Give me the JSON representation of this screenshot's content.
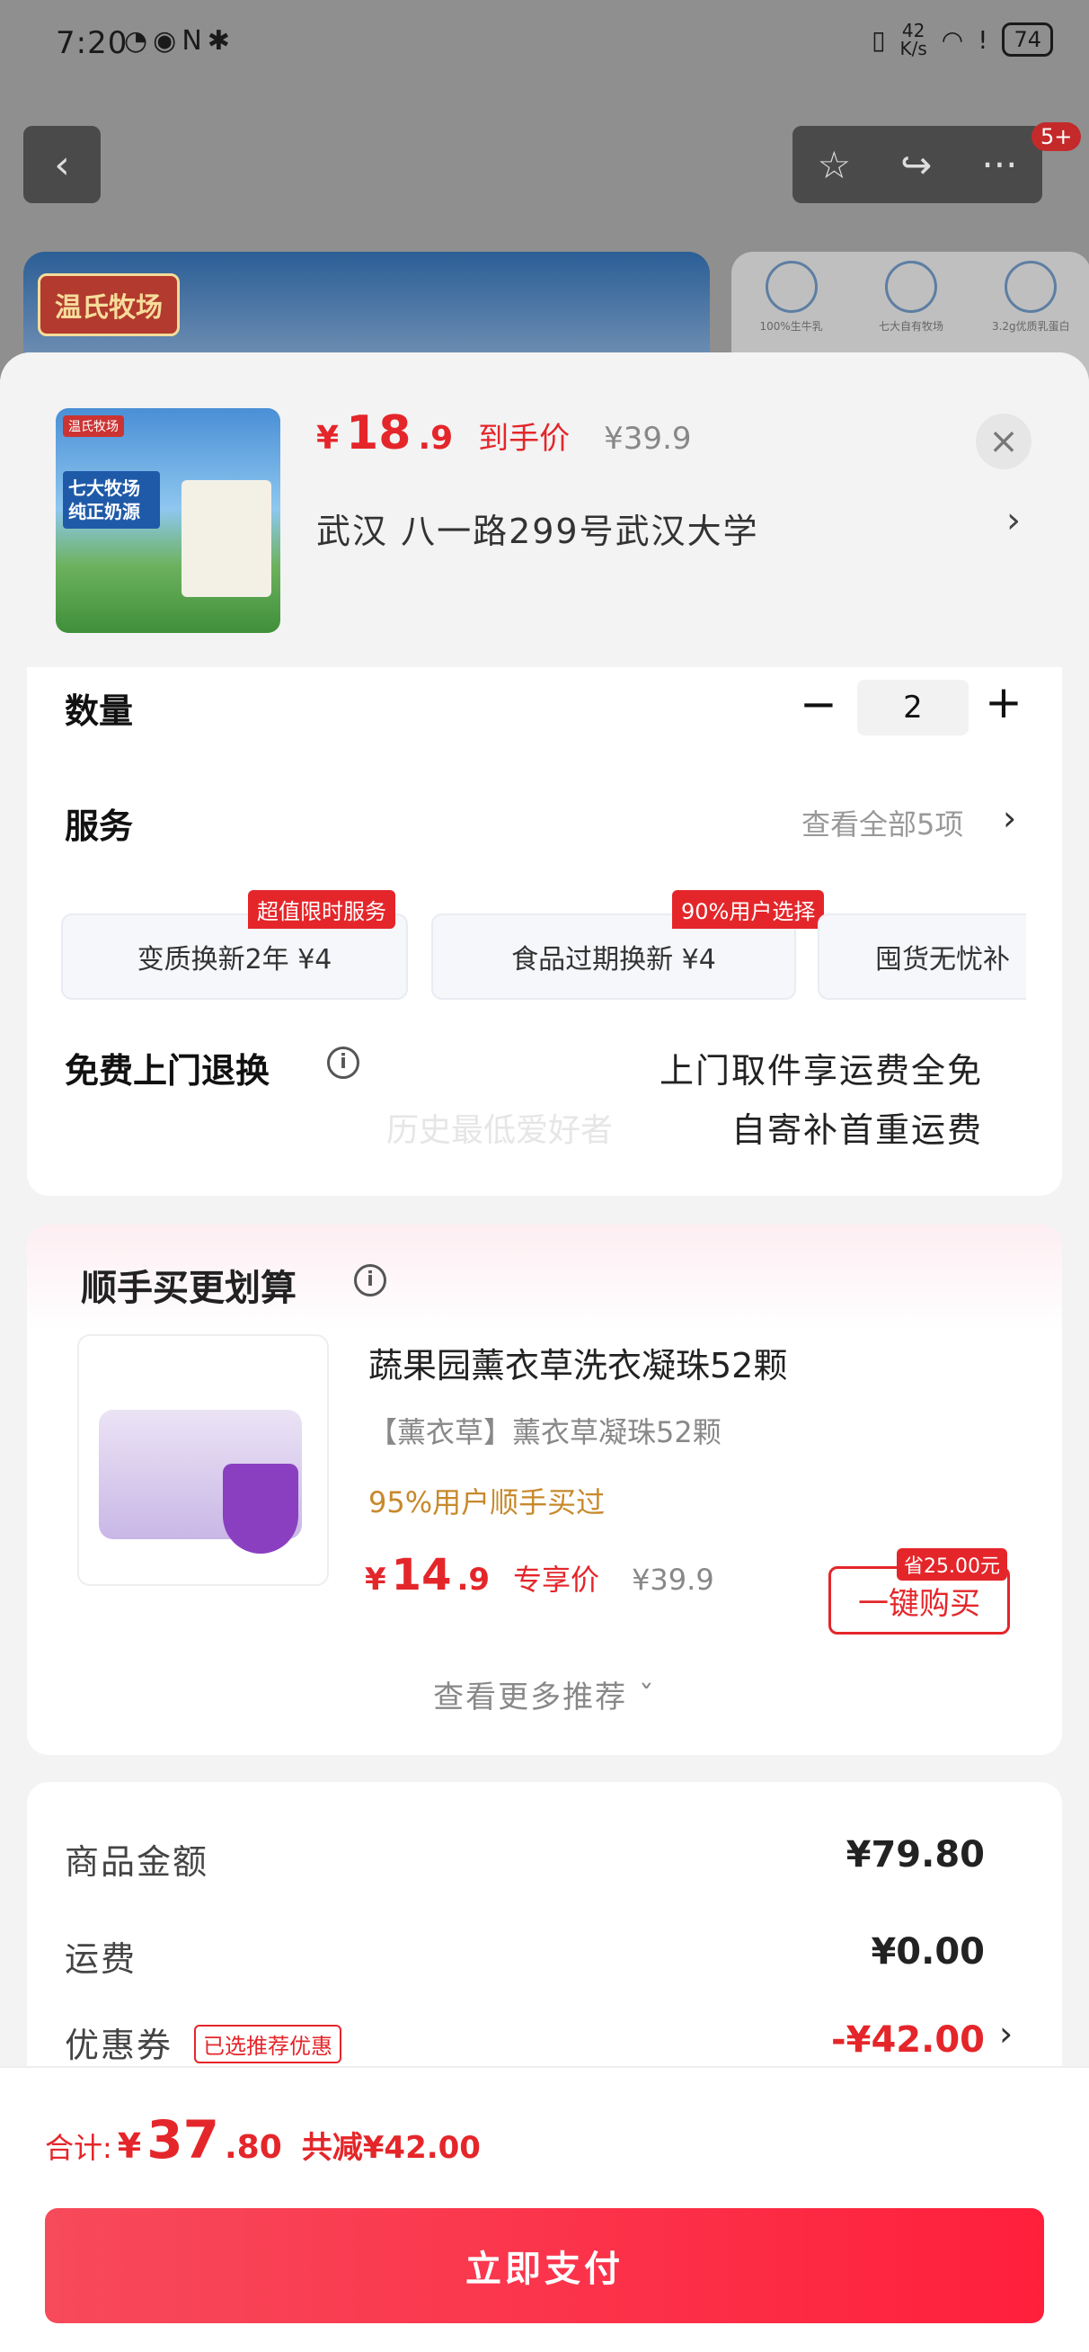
{
  "status_bar": {
    "time": "7:20",
    "left_icons": "◔◉N✱",
    "net_speed_value": "42",
    "net_speed_unit": "K/s",
    "battery": "74"
  },
  "nav": {
    "back_icon": "‹",
    "star_icon": "☆",
    "share_icon": "↪",
    "more_icon": "···",
    "cart_badge": "5+"
  },
  "banner": {
    "logo_text": "温氏牧场",
    "features": [
      "100%生牛乳",
      "七大自有牧场",
      "3.2g优质乳蛋白"
    ]
  },
  "product": {
    "thumb_tag": "温氏牧场",
    "thumb_text": "七大牧场 纯正奶源",
    "price_symbol": "¥",
    "price_int": "18",
    "price_dec": ".9",
    "price_label": "到手价",
    "original_price": "¥39.9",
    "close_icon": "×",
    "address": "武汉   八一路299号武汉大学",
    "address_chevron": "›"
  },
  "quantity": {
    "title": "数量",
    "minus": "−",
    "value": "2",
    "plus": "+"
  },
  "service": {
    "title": "服务",
    "view_all": "查看全部5项",
    "chevron": "›",
    "items": [
      {
        "label": "变质换新2年   ¥4",
        "tag": "超值限时服务"
      },
      {
        "label": "食品过期换新   ¥4",
        "tag": "90%用户选择"
      },
      {
        "label": "囤货无忧补"
      }
    ]
  },
  "returns": {
    "title": "免费上门退换",
    "info_icon": "i",
    "line1": "上门取件享运费全免",
    "line2": "自寄补首重运费",
    "watermark": "历史最低爱好者"
  },
  "addon": {
    "title": "顺手买更划算",
    "info_icon": "i",
    "name": "蔬果园薰衣草洗衣凝珠52颗",
    "variant": "【薰衣草】薰衣草凝珠52颗",
    "stat": "95%用户顺手买过",
    "price_symbol": "¥",
    "price_int": "14",
    "price_dec": ".9",
    "price_label": "专享价",
    "original_price": "¥39.9",
    "save_tag": "省25.00元",
    "buy_label": "一键购买",
    "more_label": "查看更多推荐 ˇ"
  },
  "summary": {
    "goods_label": "商品金额",
    "goods_value": "¥79.80",
    "shipping_label": "运费",
    "shipping_value": "¥0.00",
    "coupon_label": "优惠券",
    "coupon_tag": "已选推荐优惠",
    "coupon_value": "-¥42.00",
    "coupon_chevron": "›"
  },
  "checkout": {
    "total_label": "合计:",
    "total_symbol": "¥",
    "total_int": "37",
    "total_dec": ".80",
    "saved": "共减¥42.00",
    "pay_label": "立即支付"
  },
  "colors": {
    "accent": "#e4262a",
    "addon_stat": "#c7892c",
    "pay_gradient_start": "#f74a5b",
    "pay_gradient_end": "#ff1f3c"
  }
}
